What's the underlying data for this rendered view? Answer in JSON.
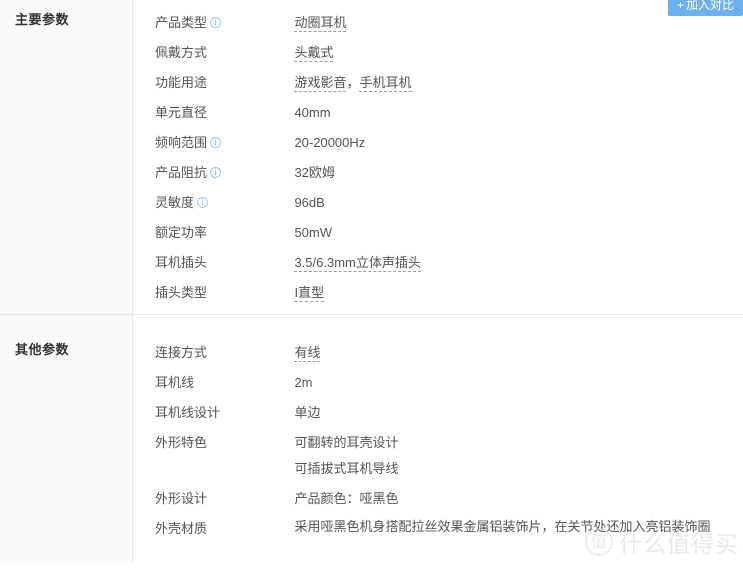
{
  "compare_button": {
    "icon": "plus-icon",
    "plus": "+",
    "label": "加入对比"
  },
  "sections": [
    {
      "key": "main",
      "title": "主要参数",
      "rows": [
        {
          "label": "产品类型",
          "has_info": true,
          "values": [
            {
              "parts": [
                {
                  "text": "动圈耳机",
                  "link": true
                }
              ]
            }
          ]
        },
        {
          "label": "佩戴方式",
          "has_info": false,
          "values": [
            {
              "parts": [
                {
                  "text": "头戴式",
                  "link": true
                }
              ]
            }
          ]
        },
        {
          "label": "功能用途",
          "has_info": false,
          "values": [
            {
              "parts": [
                {
                  "text": "游戏影音",
                  "link": true
                },
                {
                  "text": "，",
                  "link": false
                },
                {
                  "text": "手机耳机",
                  "link": true
                }
              ]
            }
          ]
        },
        {
          "label": "单元直径",
          "has_info": false,
          "values": [
            {
              "parts": [
                {
                  "text": "40mm",
                  "link": false
                }
              ]
            }
          ]
        },
        {
          "label": "频响范围",
          "has_info": true,
          "values": [
            {
              "parts": [
                {
                  "text": "20-20000Hz",
                  "link": false
                }
              ]
            }
          ]
        },
        {
          "label": "产品阻抗",
          "has_info": true,
          "values": [
            {
              "parts": [
                {
                  "text": "32欧姆",
                  "link": false
                }
              ]
            }
          ]
        },
        {
          "label": "灵敏度",
          "has_info": true,
          "values": [
            {
              "parts": [
                {
                  "text": "96dB",
                  "link": false
                }
              ]
            }
          ]
        },
        {
          "label": "额定功率",
          "has_info": false,
          "values": [
            {
              "parts": [
                {
                  "text": "50mW",
                  "link": false
                }
              ]
            }
          ]
        },
        {
          "label": "耳机插头",
          "has_info": false,
          "values": [
            {
              "parts": [
                {
                  "text": "3.5/6.3mm立体声插头",
                  "link": true
                }
              ]
            }
          ]
        },
        {
          "label": "插头类型",
          "has_info": false,
          "values": [
            {
              "parts": [
                {
                  "text": "I直型",
                  "link": true
                }
              ]
            }
          ]
        }
      ]
    },
    {
      "key": "other",
      "title": "其他参数",
      "rows": [
        {
          "label": "连接方式",
          "has_info": false,
          "values": [
            {
              "parts": [
                {
                  "text": "有线",
                  "link": true
                }
              ]
            }
          ]
        },
        {
          "label": "耳机线",
          "has_info": false,
          "values": [
            {
              "parts": [
                {
                  "text": "2m",
                  "link": false
                }
              ]
            }
          ]
        },
        {
          "label": "耳机线设计",
          "has_info": false,
          "values": [
            {
              "parts": [
                {
                  "text": "单边",
                  "link": false
                }
              ]
            }
          ]
        },
        {
          "label": "外形特色",
          "has_info": false,
          "tall": true,
          "values": [
            {
              "parts": [
                {
                  "text": "可翻转的耳壳设计",
                  "link": false
                }
              ]
            },
            {
              "parts": [
                {
                  "text": "可插拔式耳机导线",
                  "link": false
                }
              ]
            }
          ]
        },
        {
          "label": "外形设计",
          "has_info": false,
          "values": [
            {
              "parts": [
                {
                  "text": "产品颜色：哑黑色",
                  "link": false
                }
              ]
            }
          ]
        },
        {
          "label": "外壳材质",
          "has_info": false,
          "wrap": true,
          "values": [
            {
              "parts": [
                {
                  "text": "采用哑黑色机身搭配拉丝效果金属铝装饰片，在关节处还加入亮铝装饰圈",
                  "link": false
                }
              ]
            }
          ]
        }
      ]
    }
  ],
  "watermark": {
    "logo_char": "值",
    "text": "什么值得买"
  },
  "colors": {
    "accent": "#6cb0ef",
    "label_text": "#555555",
    "title_text": "#333333",
    "left_bg": "#fafafa",
    "border": "#e8e8e8",
    "info_icon": "#7fb4e0"
  }
}
